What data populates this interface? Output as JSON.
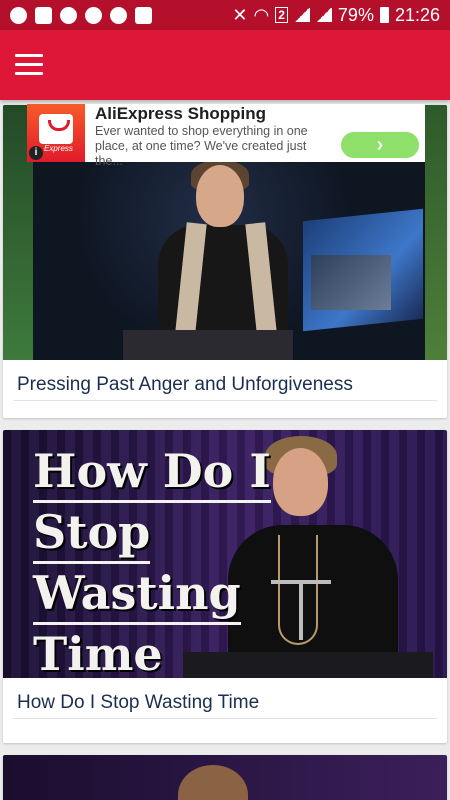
{
  "status_bar": {
    "battery_pct": "79%",
    "time": "21:26",
    "sim_slot": "2"
  },
  "app_bar": {
    "menu_icon": "hamburger-menu-icon",
    "bg_color": "#de1739"
  },
  "ad": {
    "title": "AliExpress Shopping",
    "description": "Ever wanted to shop everything in one place, at one time? We've created just the...",
    "icon_label": "Express",
    "info_icon": "i",
    "cta_icon": "›"
  },
  "videos": [
    {
      "title": "Pressing Past Anger and Unforgiveness"
    },
    {
      "title": "How Do I Stop Wasting Time",
      "thumbnail_text": [
        "How Do I",
        "Stop",
        "Wasting",
        "Time"
      ]
    }
  ]
}
